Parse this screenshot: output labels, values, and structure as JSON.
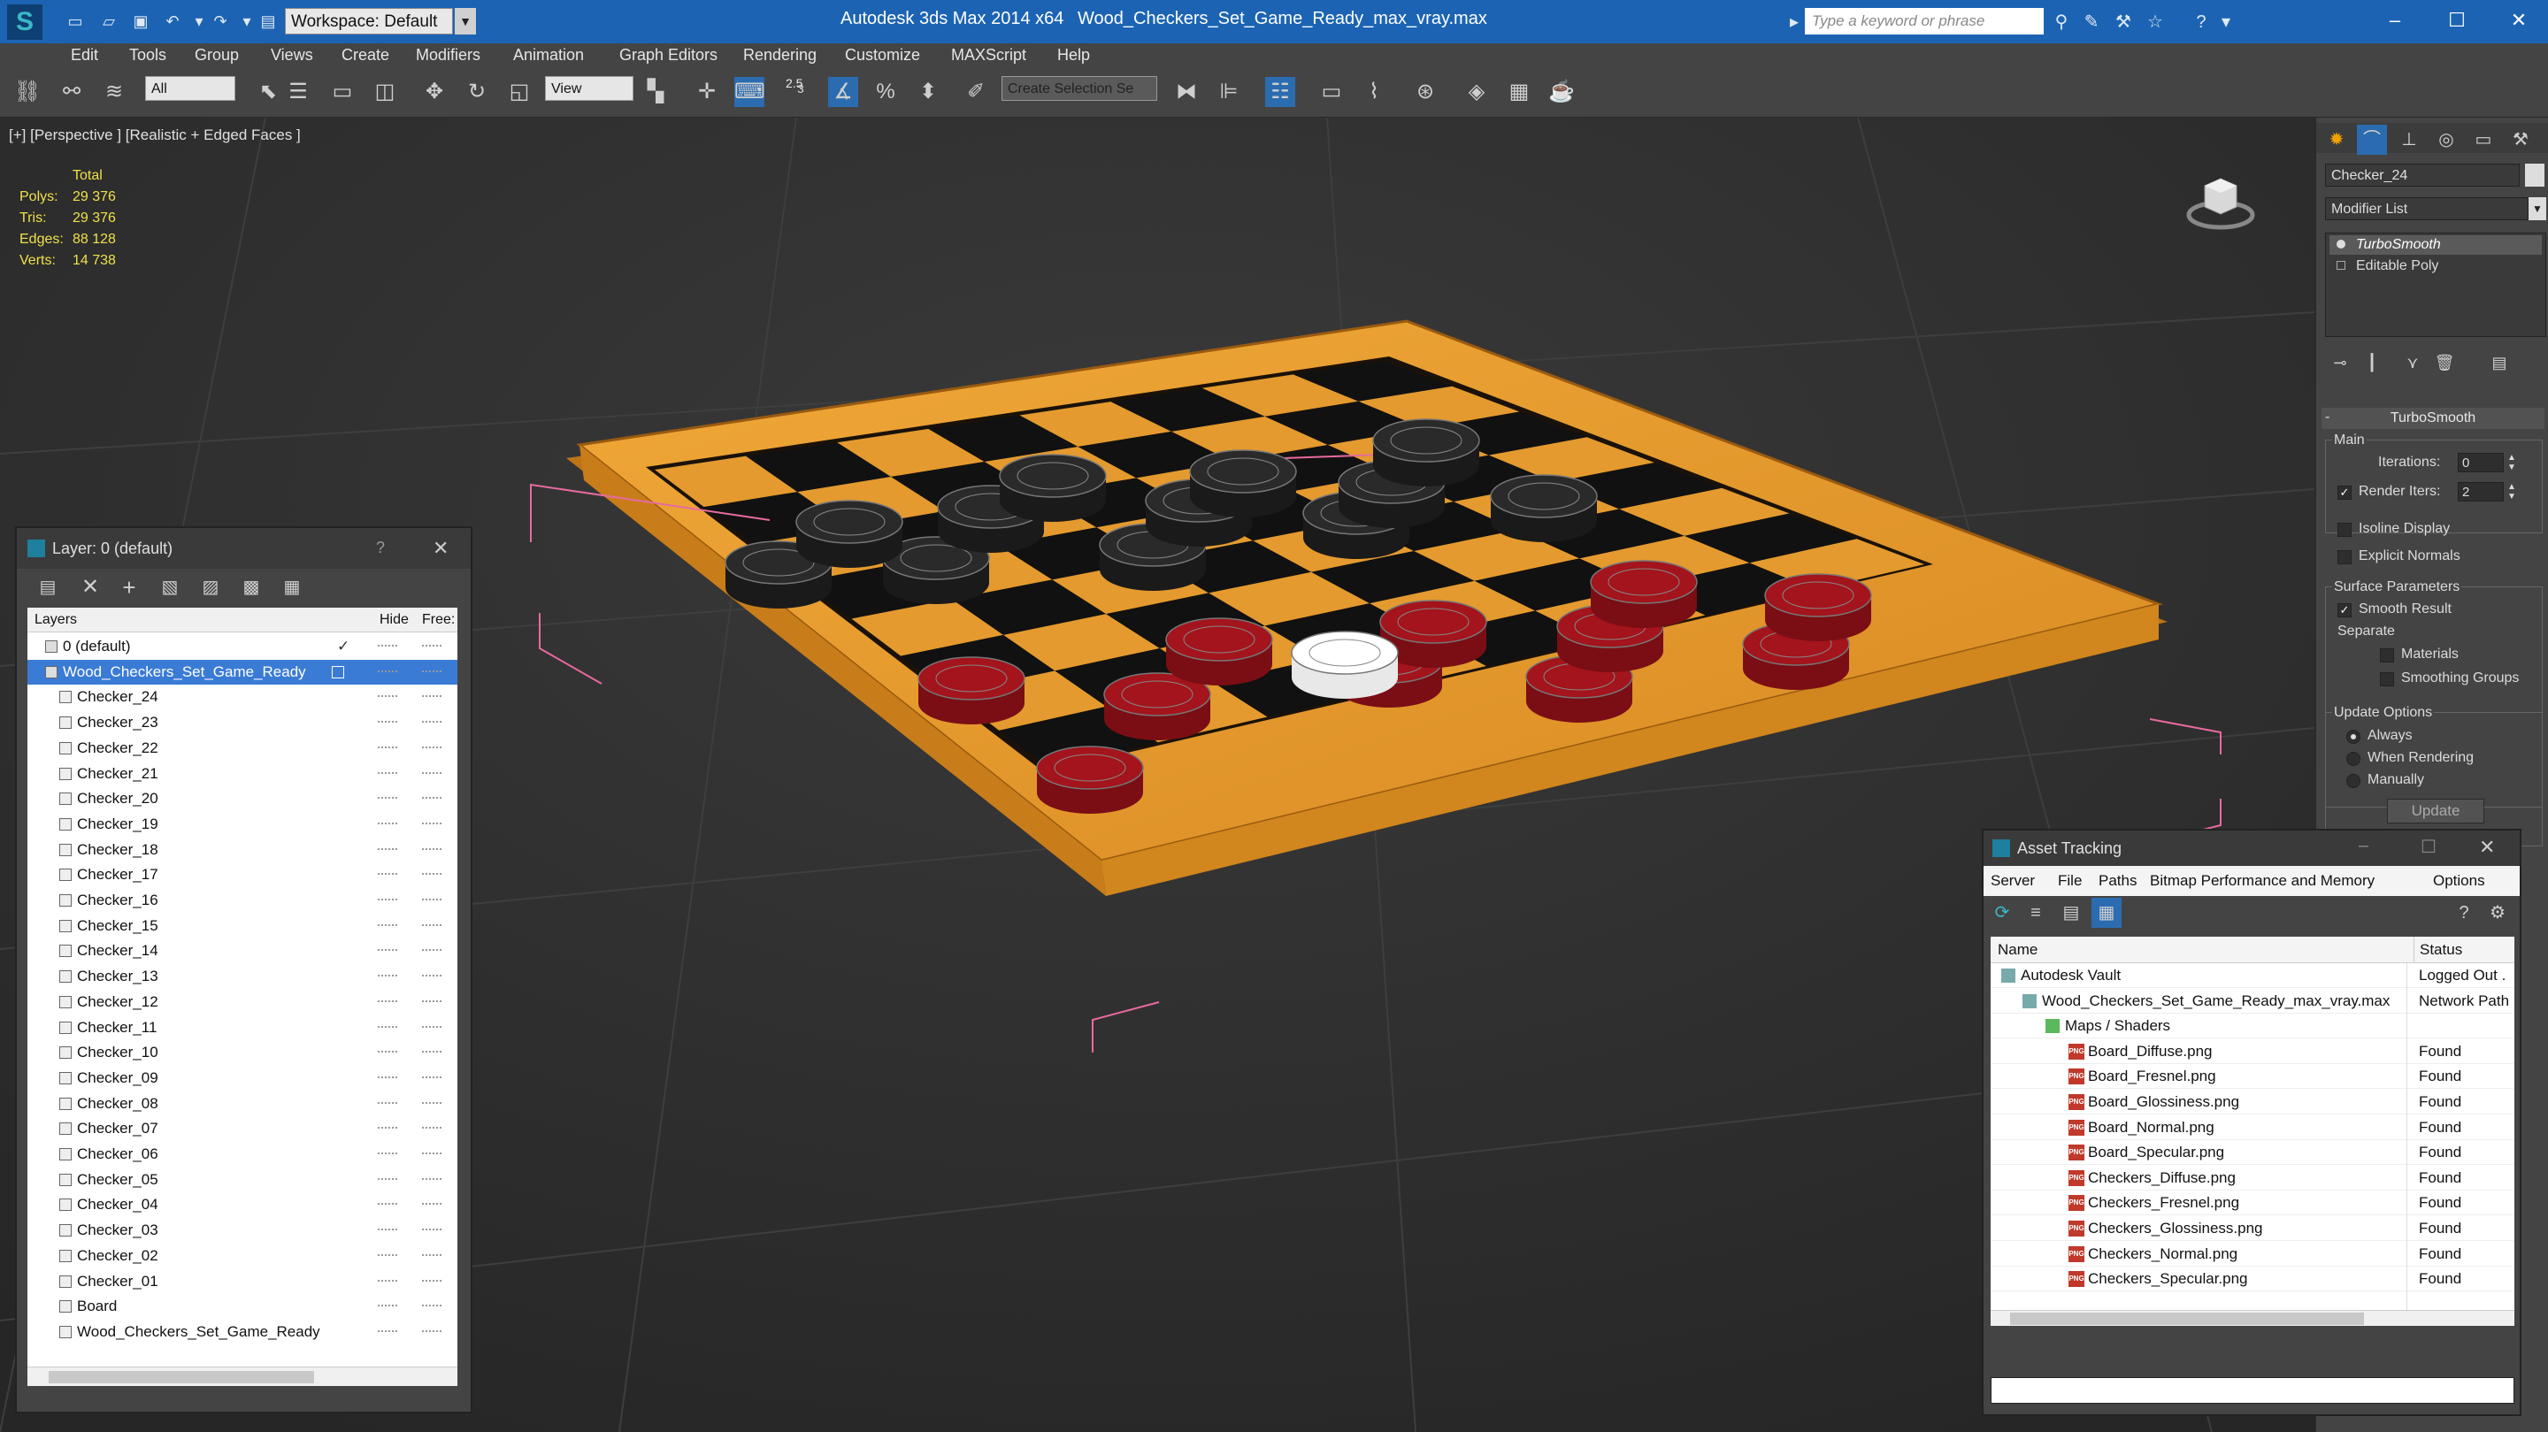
{
  "titlebar": {
    "workspace": "Workspace: Default",
    "app_title": "Autodesk 3ds Max  2014 x64",
    "file_title": "Wood_Checkers_Set_Game_Ready_max_vray.max",
    "search_placeholder": "Type a keyword or phrase"
  },
  "menu": [
    "Edit",
    "Tools",
    "Group",
    "Views",
    "Create",
    "Modifiers",
    "Animation",
    "Graph Editors",
    "Rendering",
    "Customize",
    "MAXScript",
    "Help"
  ],
  "toolbar": {
    "filter": "All",
    "ref_coord": "View",
    "snap_angle": "2.5",
    "selection_set": "Create Selection Se"
  },
  "viewport": {
    "label": "[+] [Perspective ] [Realistic + Edged Faces ]",
    "stats": {
      "header": "Total",
      "polys_k": "Polys:",
      "polys_v": "29 376",
      "tris_k": "Tris:",
      "tris_v": "29 376",
      "edges_k": "Edges:",
      "edges_v": "88 128",
      "verts_k": "Verts:",
      "verts_v": "14 738"
    }
  },
  "command_panel": {
    "object_name": "Checker_24",
    "modifier_list": "Modifier List",
    "stack": [
      "TurboSmooth",
      "Editable Poly"
    ],
    "turbosmooth": {
      "title": "TurboSmooth",
      "main": "Main",
      "iterations_label": "Iterations:",
      "iterations": "0",
      "render_iters_label": "Render Iters:",
      "render_iters": "2",
      "isoline": "Isoline Display",
      "explicit": "Explicit Normals",
      "surface": "Surface Parameters",
      "smooth_result": "Smooth Result",
      "separate": "Separate",
      "materials": "Materials",
      "smoothing_groups": "Smoothing Groups",
      "update_options": "Update Options",
      "always": "Always",
      "when_rendering": "When Rendering",
      "manually": "Manually",
      "update": "Update"
    }
  },
  "layer_panel": {
    "title": "Layer: 0 (default)",
    "help": "?",
    "col_layers": "Layers",
    "col_hide": "Hide",
    "col_freeze": "Free:",
    "rows": [
      "0 (default)",
      "Wood_Checkers_Set_Game_Ready",
      "Checker_24",
      "Checker_23",
      "Checker_22",
      "Checker_21",
      "Checker_20",
      "Checker_19",
      "Checker_18",
      "Checker_17",
      "Checker_16",
      "Checker_15",
      "Checker_14",
      "Checker_13",
      "Checker_12",
      "Checker_11",
      "Checker_10",
      "Checker_09",
      "Checker_08",
      "Checker_07",
      "Checker_06",
      "Checker_05",
      "Checker_04",
      "Checker_03",
      "Checker_02",
      "Checker_01",
      "Board",
      "Wood_Checkers_Set_Game_Ready"
    ]
  },
  "asset_panel": {
    "title": "Asset Tracking",
    "menu": [
      "Server",
      "File",
      "Paths",
      "Bitmap Performance and Memory",
      "Options"
    ],
    "col_name": "Name",
    "col_status": "Status",
    "rows": [
      {
        "name": "Autodesk Vault",
        "status": "Logged Out ."
      },
      {
        "name": "Wood_Checkers_Set_Game_Ready_max_vray.max",
        "status": "Network Path"
      },
      {
        "name": "Maps / Shaders",
        "status": ""
      },
      {
        "name": "Board_Diffuse.png",
        "status": "Found"
      },
      {
        "name": "Board_Fresnel.png",
        "status": "Found"
      },
      {
        "name": "Board_Glossiness.png",
        "status": "Found"
      },
      {
        "name": "Board_Normal.png",
        "status": "Found"
      },
      {
        "name": "Board_Specular.png",
        "status": "Found"
      },
      {
        "name": "Checkers_Diffuse.png",
        "status": "Found"
      },
      {
        "name": "Checkers_Fresnel.png",
        "status": "Found"
      },
      {
        "name": "Checkers_Glossiness.png",
        "status": "Found"
      },
      {
        "name": "Checkers_Normal.png",
        "status": "Found"
      },
      {
        "name": "Checkers_Specular.png",
        "status": "Found"
      }
    ]
  },
  "colors": {
    "titlebar": "#1c64b3",
    "panel": "#444444",
    "viewport": "#2d2d2d",
    "board_wood": "#e49a2e",
    "checker_red": "#a3141c",
    "checker_black": "#2a2a2a",
    "selection": "#ffffff",
    "stats_key": "#f0e04a"
  }
}
